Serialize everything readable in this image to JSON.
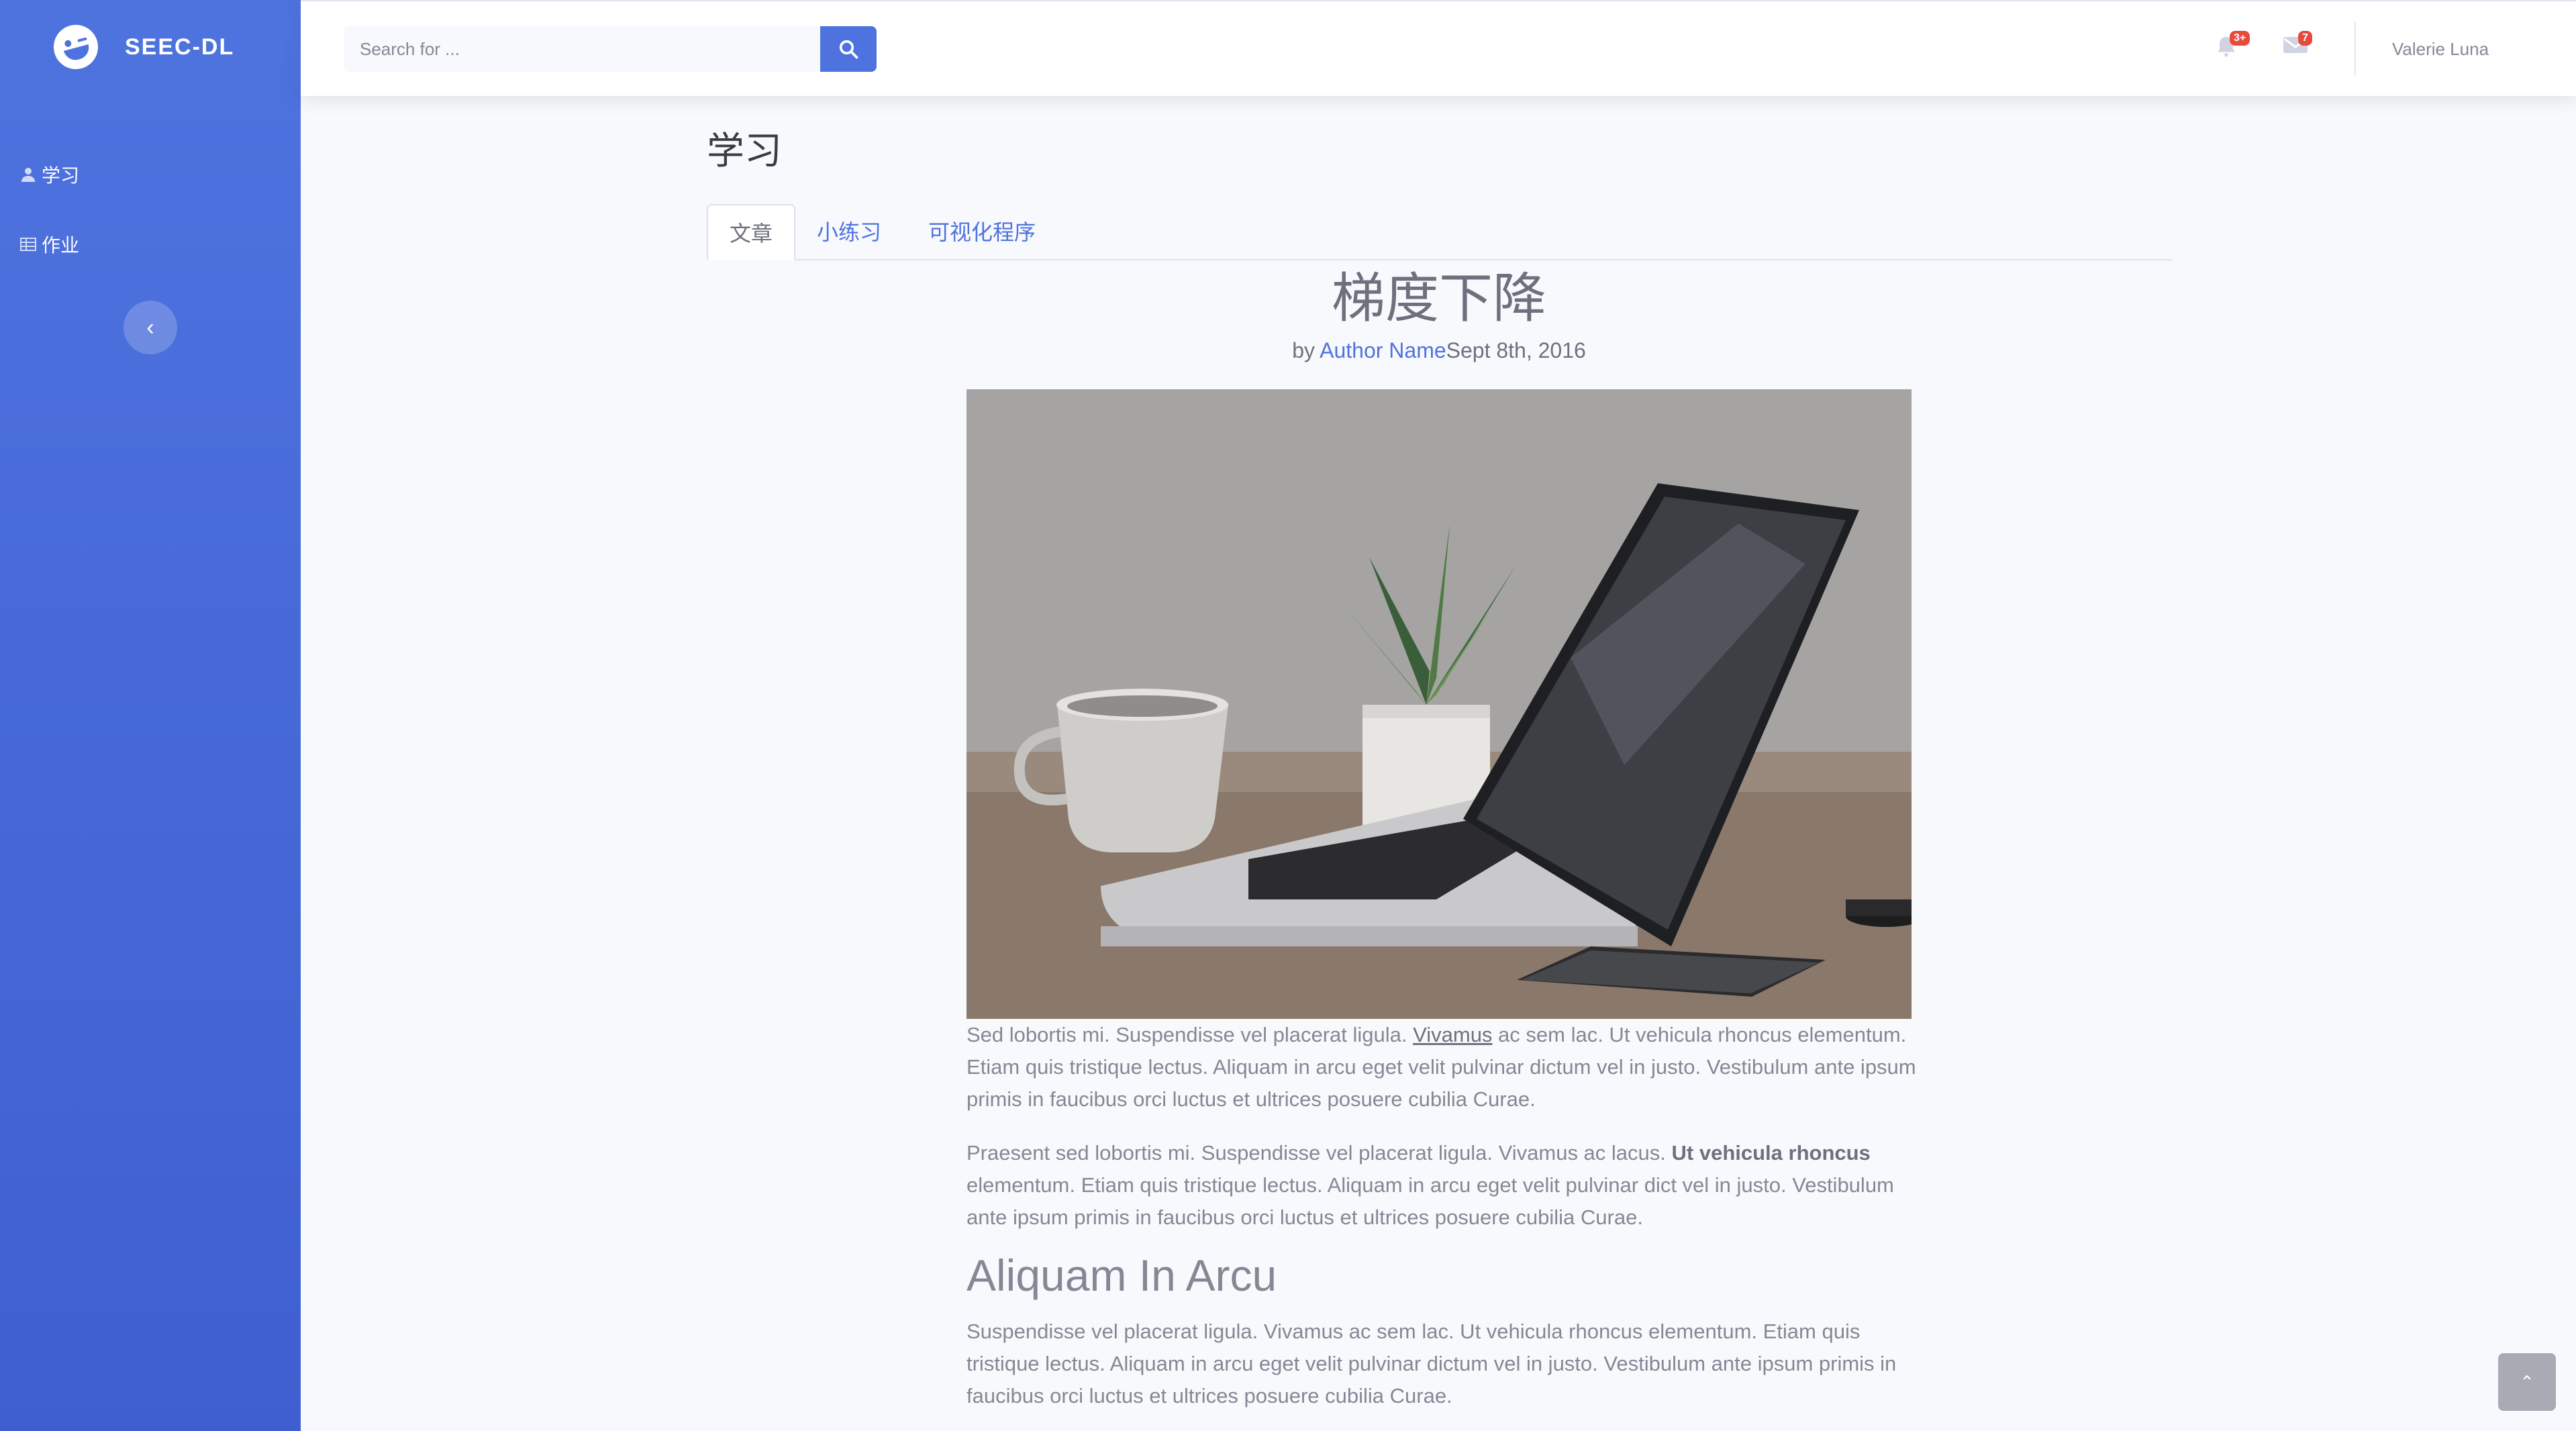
{
  "brand": {
    "name": "SEEC-DL",
    "icon": "laughing-face-icon"
  },
  "sidebar": {
    "items": [
      {
        "label": "学习",
        "icon": "user-icon"
      },
      {
        "label": "作业",
        "icon": "table-icon"
      }
    ],
    "toggle_icon": "chevron-left-icon"
  },
  "topbar": {
    "search_placeholder": "Search for ...",
    "alerts_badge": "3+",
    "messages_badge": "7",
    "user_name": "Valerie Luna"
  },
  "page": {
    "title": "学习",
    "tabs": [
      "文章",
      "小练习",
      "可视化程序"
    ],
    "active_tab": 0
  },
  "article": {
    "title": "梯度下降",
    "by": "by ",
    "author": "Author Name",
    "date": "Sept 8th, 2016",
    "p1_a": "Sed lobortis mi. Suspendisse vel placerat ligula. ",
    "p1_link": "Vivamus",
    "p1_b": " ac sem lac. Ut vehicula rhoncus elementum. Etiam quis tristique lectus. Aliquam in arcu eget velit pulvinar dictum vel in justo. Vestibulum ante ipsum primis in faucibus orci luctus et ultrices posuere cubilia Curae.",
    "p2_a": "Praesent sed lobortis mi. Suspendisse vel placerat ligula. Vivamus ac lacus. ",
    "p2_bold": "Ut vehicula rhoncus",
    "p2_b": " elementum. Etiam quis tristique lectus. Aliquam in arcu eget velit pulvinar dict vel in justo. Vestibulum ante ipsum primis in faucibus orci luctus et ultrices posuere cubilia Curae.",
    "h2": "Aliquam In Arcu",
    "p3": "Suspendisse vel placerat ligula. Vivamus ac sem lac. Ut vehicula rhoncus elementum. Etiam quis tristique lectus. Aliquam in arcu eget velit pulvinar dictum vel in justo. Vestibulum ante ipsum primis in faucibus orci luctus et ultrices posuere cubilia Curae."
  },
  "scroll_top_icon": "chevron-up-icon"
}
